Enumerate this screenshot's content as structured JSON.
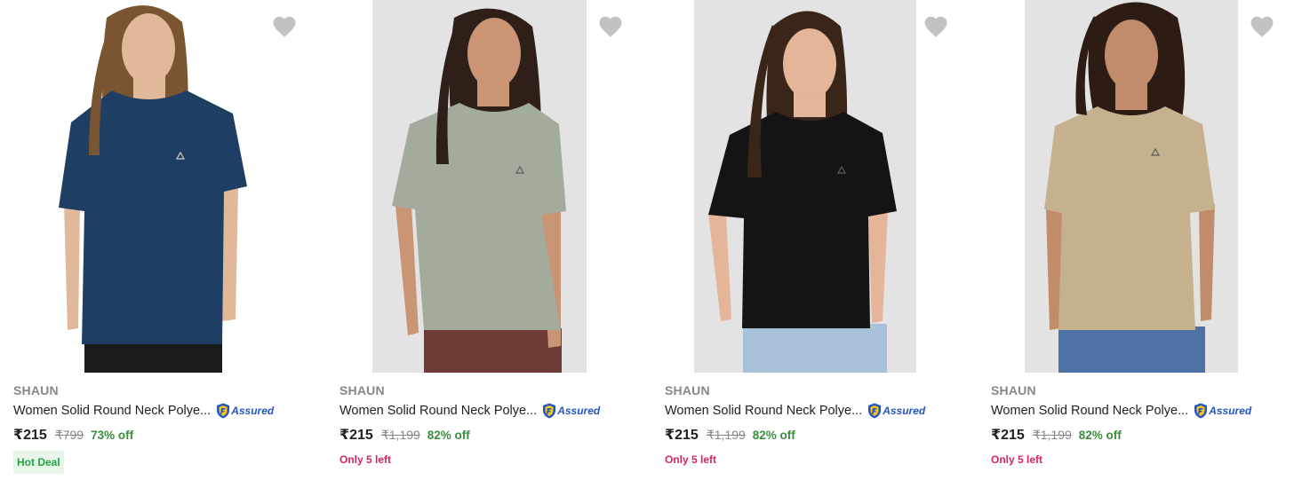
{
  "products": [
    {
      "brand": "SHAUN",
      "title": "Women Solid Round Neck Polye...",
      "assured_label": "Assured",
      "price": "₹215",
      "mrp": "₹799",
      "discount": "73% off",
      "badge": "Hot Deal",
      "shirt_color": "#1e3f63",
      "pants_color": "#1a1a1a",
      "hair_color": "#7a5532",
      "skin_color": "#e2b89a",
      "background": "white",
      "wishlisted": false
    },
    {
      "brand": "SHAUN",
      "title": "Women Solid Round Neck Polye...",
      "assured_label": "Assured",
      "price": "₹215",
      "mrp": "₹1,199",
      "discount": "82% off",
      "stock_note": "Only 5 left",
      "shirt_color": "#a3ab9c",
      "pants_color": "#6e3b36",
      "hair_color": "#2e2019",
      "skin_color": "#c99574",
      "background": "grey",
      "wishlisted": false
    },
    {
      "brand": "SHAUN",
      "title": "Women Solid Round Neck Polye...",
      "assured_label": "Assured",
      "price": "₹215",
      "mrp": "₹1,199",
      "discount": "82% off",
      "stock_note": "Only 5 left",
      "shirt_color": "#141414",
      "pants_color": "#a7c1d9",
      "hair_color": "#3a2519",
      "skin_color": "#e4b598",
      "background": "grey",
      "wishlisted": false
    },
    {
      "brand": "SHAUN",
      "title": "Women Solid Round Neck Polye...",
      "assured_label": "Assured",
      "price": "₹215",
      "mrp": "₹1,199",
      "discount": "82% off",
      "stock_note": "Only 5 left",
      "shirt_color": "#c5b18d",
      "pants_color": "#4f72a6",
      "hair_color": "#2c1c13",
      "skin_color": "#c08c6c",
      "background": "grey",
      "wishlisted": false
    }
  ],
  "colors": {
    "heart": "#c2c2c2",
    "discount": "#388e3c",
    "stock": "#d6255e",
    "assured_blue": "#2455c3",
    "assured_gold": "#f5c518"
  },
  "icons": {
    "wishlist": "heart-icon",
    "assured": "assured-shield-icon"
  }
}
